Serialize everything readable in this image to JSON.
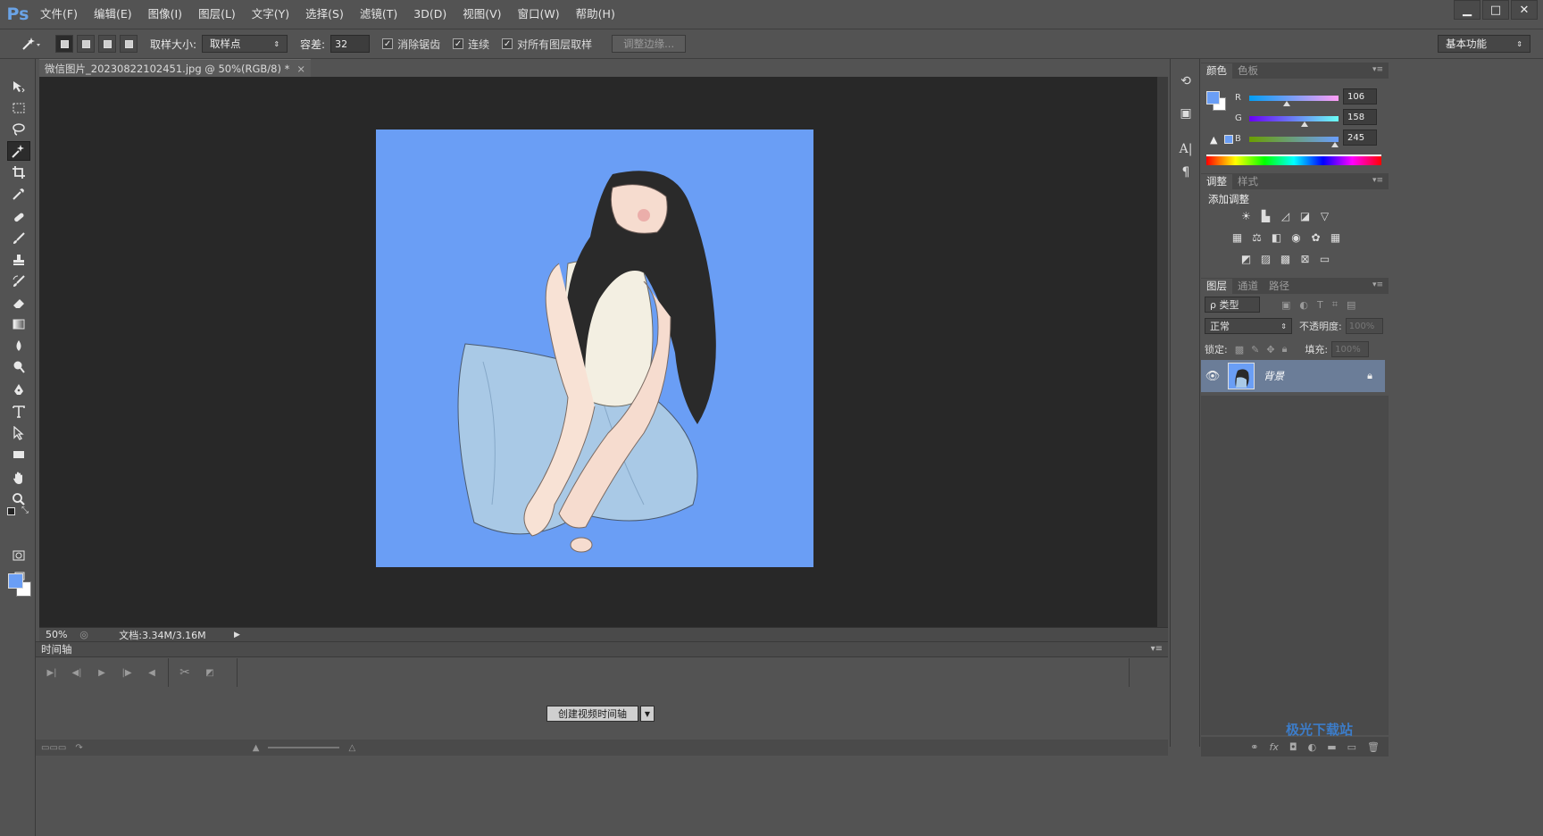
{
  "app": {
    "logo": "Ps"
  },
  "menu": [
    "文件(F)",
    "编辑(E)",
    "图像(I)",
    "图层(L)",
    "文字(Y)",
    "选择(S)",
    "滤镜(T)",
    "3D(D)",
    "视图(V)",
    "窗口(W)",
    "帮助(H)"
  ],
  "window_controls": {
    "minimize": "▁",
    "maximize": "□",
    "close": "✕"
  },
  "options": {
    "sample_size_label": "取样大小:",
    "sample_size_value": "取样点",
    "tolerance_label": "容差:",
    "tolerance_value": "32",
    "antialias_label": "消除锯齿",
    "contiguous_label": "连续",
    "all_layers_label": "对所有图层取样",
    "refine_edge_label": "调整边缘...",
    "workspace_value": "基本功能"
  },
  "document": {
    "tab_title": "微信图片_20230822102451.jpg @ 50%(RGB/8) *",
    "canvas_color": "#6a9ef5"
  },
  "status": {
    "zoom": "50%",
    "doc_info": "文档:3.34M/3.16M"
  },
  "timeline": {
    "title": "时间轴",
    "create_button": "创建视频时间轴"
  },
  "color_panel": {
    "tabs": [
      "颜色",
      "色板"
    ],
    "r_label": "R",
    "r_value": "106",
    "g_label": "G",
    "g_value": "158",
    "b_label": "B",
    "b_value": "245",
    "foreground": "#6a9ef5",
    "background": "#ffffff"
  },
  "adjust_panel": {
    "tabs": [
      "调整",
      "样式"
    ],
    "title": "添加调整"
  },
  "layers_panel": {
    "tabs": [
      "图层",
      "通道",
      "路径"
    ],
    "filter_label": "ρ 类型",
    "blend_mode": "正常",
    "opacity_label": "不透明度:",
    "opacity_value": "100%",
    "lock_label": "锁定:",
    "fill_label": "填充:",
    "fill_value": "100%",
    "layer_name": "背景"
  },
  "watermark": "极光下载站"
}
